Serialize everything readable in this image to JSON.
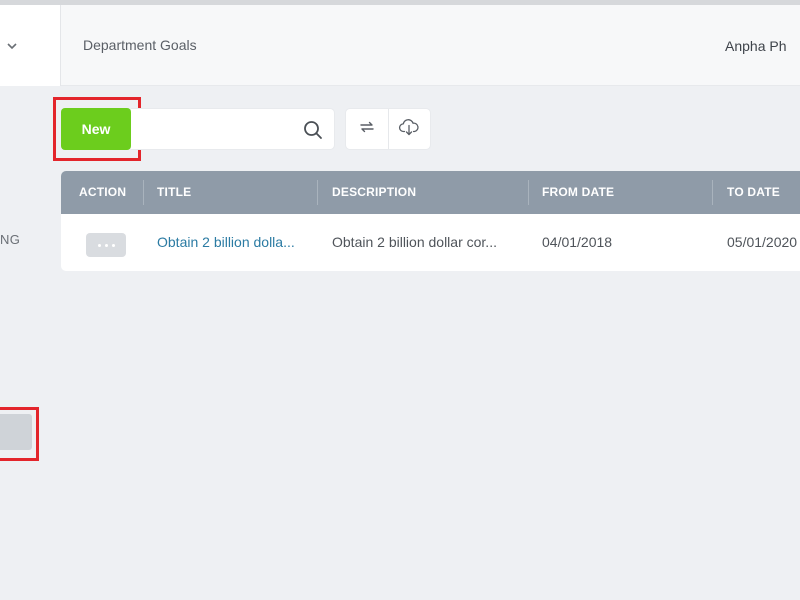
{
  "header": {
    "title": "Department Goals",
    "user_name": "Anpha Ph"
  },
  "sidebar": {
    "collapse_icon": "chevron-down-icon",
    "partial_item_text": "NG"
  },
  "toolbar": {
    "new_label": "New",
    "search_placeholder": "",
    "search_icon": "search-icon",
    "refresh_icon": "refresh-icon",
    "download_icon": "cloud-download-icon"
  },
  "table": {
    "columns": [
      "ACTION",
      "TITLE",
      "DESCRIPTION",
      "FROM DATE",
      "TO DATE"
    ],
    "rows": [
      {
        "title": "Obtain 2 billion dolla...",
        "description": "Obtain 2 billion dollar cor...",
        "from_date": "04/01/2018",
        "to_date": "05/01/2020"
      }
    ]
  },
  "colors": {
    "accent_green": "#6ccd1d",
    "highlight_red": "#e3252b",
    "header_gray": "#8f9ba8",
    "link_blue": "#2b7ba3"
  }
}
